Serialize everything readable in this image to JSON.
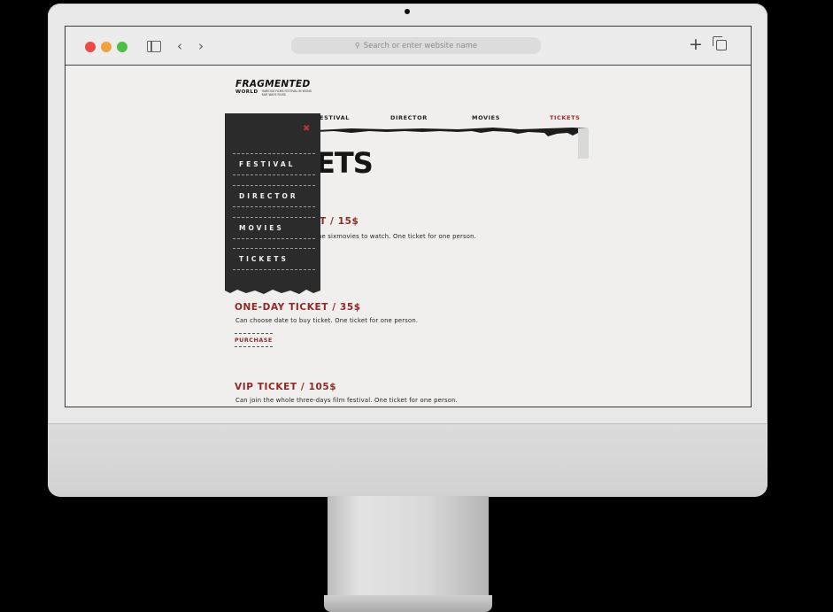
{
  "browser": {
    "url_placeholder": "Search or enter website name"
  },
  "site": {
    "logo_main": "FRAGMENTED",
    "logo_sub": "WORLD",
    "logo_tagline": "Various films festival in Wong Kar Wai's films"
  },
  "nav": {
    "festival": "FESTIVAL",
    "director": "DIRECTOR",
    "movies": "MOVIES",
    "tickets": "TICKETS"
  },
  "hero": {
    "title_visible": "ETS"
  },
  "menu": {
    "close": "✖",
    "items": [
      "FESTIVAL",
      "DIRECTOR",
      "MOVIES",
      "TICKETS"
    ]
  },
  "tickets": [
    {
      "title_visible": "T / 15$",
      "desc_visible": "he sixmovies to watch. One ticket for one person."
    },
    {
      "title": "ONE-DAY TICKET / 35$",
      "desc": "Can choose date to buy ticket. One ticket for one person.",
      "action": "PURCHASE"
    },
    {
      "title": "VIP TICKET / 105$",
      "desc": "Can join the whole three-days film festival. One ticket for one person."
    }
  ],
  "colors": {
    "accent": "#8e2a25",
    "menu_bg": "#2b2b2b",
    "page_bg": "#f0efee"
  }
}
